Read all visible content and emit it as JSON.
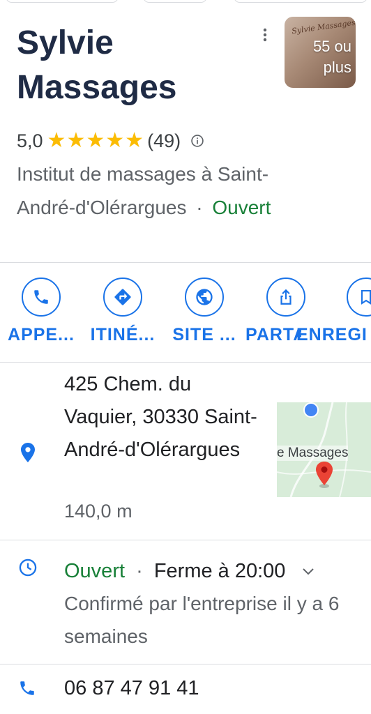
{
  "business": {
    "name": "Sylvie Massages",
    "photo_count": "55 ou plus",
    "photo_script": "Sylvie Massages",
    "rating": "5,0",
    "stars": 5,
    "review_count": "(49)",
    "category_line": "Institut de massages à Saint-André-d'Olérargues",
    "separator": "·",
    "status": "Ouvert"
  },
  "actions": [
    {
      "label": "APPE...",
      "icon": "phone-icon"
    },
    {
      "label": "ITINÉ...",
      "icon": "directions-icon"
    },
    {
      "label": "SITE ...",
      "icon": "globe-icon"
    },
    {
      "label": "PARTAGER",
      "icon": "share-icon"
    },
    {
      "label": "ENREGI",
      "icon": "bookmark-icon"
    }
  ],
  "address": {
    "text": "425 Chem. du Vaquier, 30330 Saint-André-d'Olérargues",
    "distance": "140,0 m",
    "map_label": "e Massages"
  },
  "hours": {
    "status": "Ouvert",
    "separator": "·",
    "closes": "Ferme à 20:00",
    "confirmed": "Confirmé par l'entreprise il y a 6 semaines"
  },
  "phone": {
    "number": "06 87 47 91 41"
  },
  "colors": {
    "accent": "#1a73e8",
    "open": "#188038",
    "star": "#fbbc04",
    "title": "#1f2b45"
  }
}
